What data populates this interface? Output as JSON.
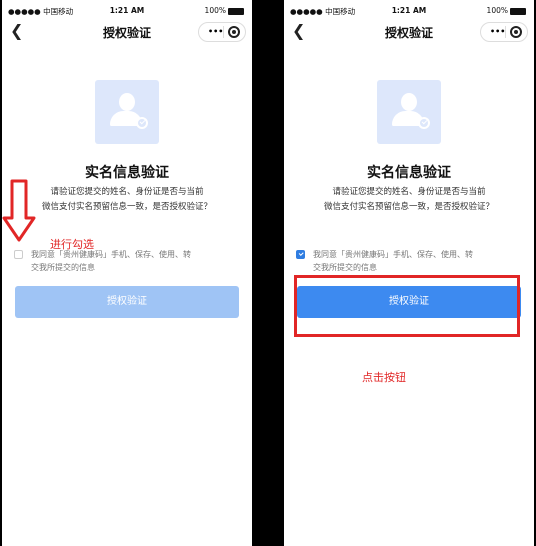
{
  "status_bar": {
    "carrier": "●●●●● 中国移动",
    "wifi_icon": "wifi-icon",
    "time": "1:21 AM",
    "battery": "100%"
  },
  "nav": {
    "back_icon": "chevron-left-icon",
    "title": "授权验证",
    "more_icon": "•••",
    "close_icon": "target-circle-icon"
  },
  "content": {
    "title": "实名信息验证",
    "desc_line1": "请验证您提交的姓名、身份证是否与当前",
    "desc_line2": "微信支付实名预留信息一致，是否授权验证？",
    "agree_line1": "我同意「贵州健康码」手机、保存、使用、转",
    "agree_line2": "交我所提交的信息",
    "button_label": "授权验证"
  },
  "screens": [
    {
      "checkbox_checked": false,
      "button_enabled": false
    },
    {
      "checkbox_checked": true,
      "button_enabled": true
    }
  ],
  "annotations": {
    "left": "进行勾选",
    "right": "点击按钮",
    "color": "#e12626"
  },
  "colors": {
    "button_active": "#3d8af0",
    "button_disabled": "#9fc4f5",
    "avatar_bg": "#dde7fb"
  }
}
